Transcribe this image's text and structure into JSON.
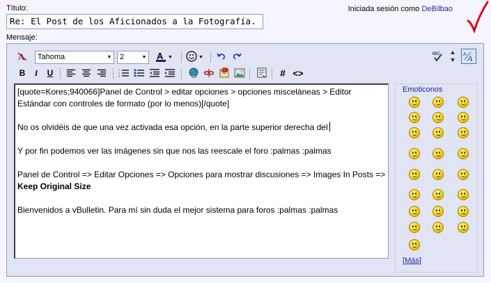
{
  "form": {
    "title_label": "Título:",
    "title_value": "Re: El Post de los Aficionados a la Fotografía.",
    "message_label": "Mensaje:"
  },
  "login": {
    "prefix": "Iniciada sesión como",
    "user": "DeBilbao"
  },
  "toolbar": {
    "font_name": "Tahoma",
    "font_size": "2",
    "spell_label": "ABC"
  },
  "message": {
    "lines": [
      "[quote=Kores;940066]Panel de Control > editar opciones > opciones misceláneas > Editor Estándar con controles de formato (por lo menos)[/quote]",
      "No os olvidéis de que una vez activada esa opción, en la parte superior derecha del",
      "Y por fin podemos ver las imágenes sin que nos las reescale el foro :palmas :palmas",
      "Panel de Control => Editar Opciones => Opciones para mostrar discusiones => Images In Posts => ",
      "Keep Original Size",
      "Bienvenidos a vBulletin. Para mí sin duda el mejor sistema para foros :palmas :palmas"
    ]
  },
  "smilies": {
    "title": "Emoticonos",
    "more": "Más",
    "bracket_open": "[",
    "bracket_close": "]"
  },
  "colors": {
    "accent": "#22229c",
    "checkmark": "#e0001b"
  }
}
